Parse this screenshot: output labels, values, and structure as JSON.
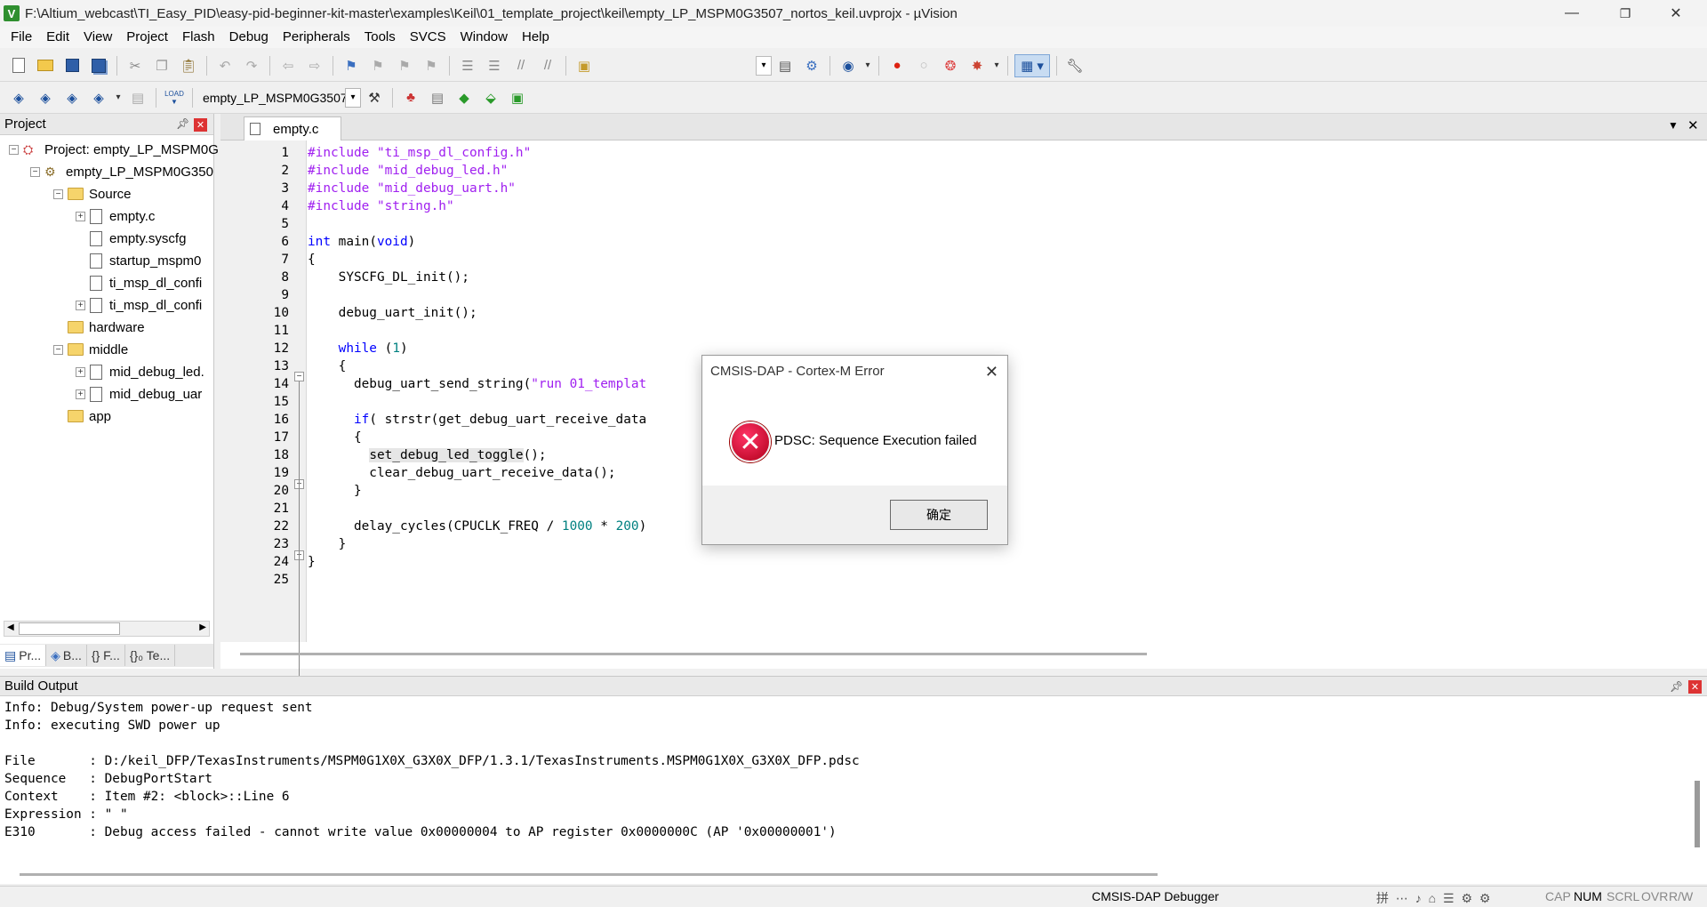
{
  "window": {
    "title": "F:\\Altium_webcast\\TI_Easy_PID\\easy-pid-beginner-kit-master\\examples\\Keil\\01_template_project\\keil\\empty_LP_MSPM0G3507_nortos_keil.uvprojx - µVision",
    "minimize": "—",
    "restore": "❐",
    "close": "✕"
  },
  "menu": [
    "File",
    "Edit",
    "View",
    "Project",
    "Flash",
    "Debug",
    "Peripherals",
    "Tools",
    "SVCS",
    "Window",
    "Help"
  ],
  "toolbar2": {
    "target_combo": "empty_LP_MSPM0G3507_",
    "load_label": "LOAD"
  },
  "project_pane": {
    "title": "Project",
    "tree": [
      {
        "label": "Project: empty_LP_MSPM0G",
        "level": 0,
        "kind": "project",
        "expander": "⊟"
      },
      {
        "label": "empty_LP_MSPM0G350",
        "level": 1,
        "kind": "target",
        "expander": "⊟"
      },
      {
        "label": "Source",
        "level": 2,
        "kind": "folder",
        "expander": "⊟"
      },
      {
        "label": "empty.c",
        "level": 3,
        "kind": "file",
        "expander": "⊞"
      },
      {
        "label": "empty.syscfg",
        "level": 3,
        "kind": "file",
        "expander": ""
      },
      {
        "label": "startup_mspm0",
        "level": 3,
        "kind": "file",
        "expander": ""
      },
      {
        "label": "ti_msp_dl_confi",
        "level": 3,
        "kind": "file",
        "expander": ""
      },
      {
        "label": "ti_msp_dl_confi",
        "level": 3,
        "kind": "file",
        "expander": "⊞"
      },
      {
        "label": "hardware",
        "level": 2,
        "kind": "folder",
        "expander": ""
      },
      {
        "label": "middle",
        "level": 2,
        "kind": "folder",
        "expander": "⊟"
      },
      {
        "label": "mid_debug_led.",
        "level": 3,
        "kind": "file",
        "expander": "⊞"
      },
      {
        "label": "mid_debug_uar",
        "level": 3,
        "kind": "file",
        "expander": "⊞"
      },
      {
        "label": "app",
        "level": 2,
        "kind": "folder",
        "expander": ""
      }
    ],
    "tabs": [
      "Pr...",
      "B...",
      "{} F...",
      "{}₀ Te..."
    ]
  },
  "editor": {
    "tab_label": "empty.c",
    "lines": [
      "1",
      "2",
      "3",
      "4",
      "5",
      "6",
      "7",
      "8",
      "9",
      "10",
      "11",
      "12",
      "13",
      "14",
      "15",
      "16",
      "17",
      "18",
      "19",
      "20",
      "21",
      "22",
      "23",
      "24",
      "25"
    ],
    "code": {
      "l1": "\"ti_msp_dl_config.h\"",
      "l2": "\"mid_debug_led.h\"",
      "l3": "\"mid_debug_uart.h\"",
      "l4": "\"string.h\"",
      "l6_kw": "int",
      "l6_rest": " main(",
      "l6_void": "void",
      "l6_end": ")",
      "l7": "{",
      "l8": "    SYSCFG_DL_init();",
      "l10": "    debug_uart_init();",
      "l12_kw": "while",
      "l12_rest": " (",
      "l12_num": "1",
      "l12_end": ")",
      "l13": "    {",
      "l14_a": "      debug_uart_send_string(",
      "l14_b": "\"run 01_templat",
      "l16_kw": "if",
      "l16_rest": "( strstr(get_debug_uart_receive_data",
      "l17": "      {",
      "l18_hl": "set_debug_led_toggle",
      "l18_rest": "();",
      "l19": "        clear_debug_uart_receive_data();",
      "l20": "      }",
      "l22_a": "      delay_cycles(CPUCLK_FREQ / ",
      "l22_n1": "1000",
      "l22_b": " * ",
      "l22_n2": "200",
      "l22_c": ")",
      "l23": "    }",
      "l24": "}",
      "include": "#include"
    }
  },
  "build_output": {
    "title": "Build Output",
    "lines": [
      "Info: Debug/System power-up request sent",
      "Info: executing SWD power up",
      "",
      "File       : D:/keil_DFP/TexasInstruments/MSPM0G1X0X_G3X0X_DFP/1.3.1/TexasInstruments.MSPM0G1X0X_G3X0X_DFP.pdsc",
      "Sequence   : DebugPortStart",
      "Context    : Item #2: <block>::Line 6",
      "Expression : \" \"",
      "E310       : Debug access failed - cannot write value 0x00000004 to AP register 0x0000000C (AP '0x00000001')"
    ]
  },
  "status_bar": {
    "debugger": "CMSIS-DAP Debugger",
    "cap": "CAP",
    "num": "NUM",
    "scrl": "SCRL",
    "ovr": "OVR",
    "rw": "R/W"
  },
  "dialog": {
    "title": "CMSIS-DAP - Cortex-M Error",
    "message": "PDSC: Sequence Execution failed",
    "ok_label": "确定",
    "close": "✕",
    "icon": "error-icon"
  },
  "colors": {
    "keyword": "#0000ff",
    "preprocessor": "#a020f0",
    "number": "#008080",
    "error_icon": "#c8102e"
  }
}
